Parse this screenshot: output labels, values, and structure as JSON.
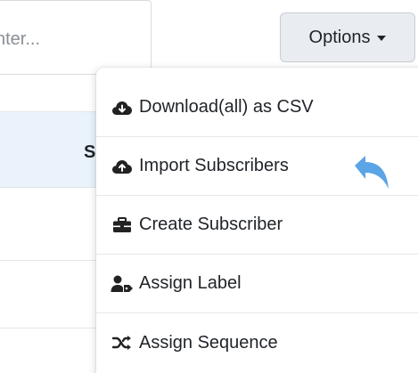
{
  "search": {
    "placeholder": "nter..."
  },
  "table": {
    "visible_header_letter": "S"
  },
  "options_button": {
    "label": "Options",
    "caret_icon": "caret-down-icon"
  },
  "dropdown": {
    "items": [
      {
        "label": "Download(all) as CSV",
        "icon": "cloud-download-icon"
      },
      {
        "label": "Import Subscribers",
        "icon": "cloud-upload-icon"
      },
      {
        "label": "Create Subscriber",
        "icon": "toolbox-icon"
      },
      {
        "label": "Assign Label",
        "icon": "user-tag-icon"
      },
      {
        "label": "Assign Sequence",
        "icon": "shuffle-icon"
      }
    ]
  },
  "annotation": {
    "icon": "undo-arrow-icon",
    "color": "#5ba4e6"
  },
  "colors": {
    "button_bg": "#e9edf1",
    "row_highlight": "#eaf3fb",
    "text": "#1f2328"
  }
}
